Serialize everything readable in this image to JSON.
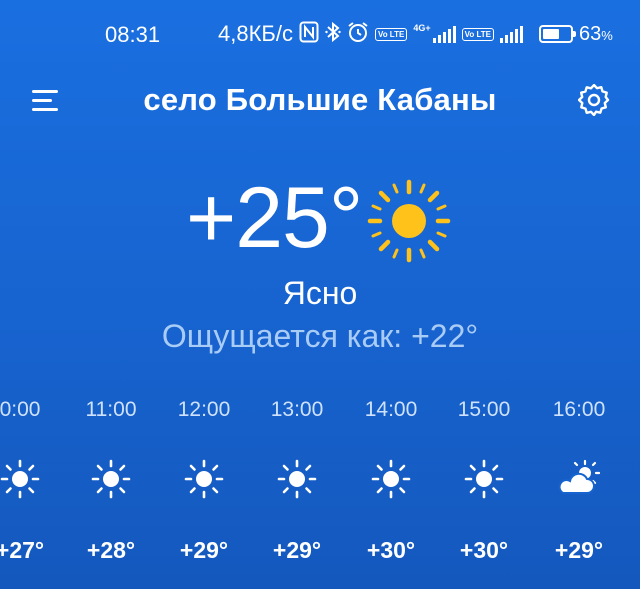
{
  "status_bar": {
    "time": "08:31",
    "net_speed": "4,8КБ/с",
    "nfc_icon": "nfc-icon",
    "bluetooth_icon": "bluetooth-icon",
    "alarm_icon": "alarm-icon",
    "sim1_label": "Vo LTE",
    "sim1_network": "4G+",
    "sim2_label": "Vo LTE",
    "battery_level": 0.63,
    "battery_pct": "63",
    "battery_suffix": "%"
  },
  "header": {
    "menu_icon": "menu-icon",
    "title": "село Большие Кабаны",
    "settings_icon": "gear-icon"
  },
  "current": {
    "temp": "+25°",
    "icon": "sun-icon",
    "condition": "Ясно",
    "feels_like": "Ощущается как: +22°"
  },
  "hourly": [
    {
      "time": "0:00",
      "icon": "sun-icon",
      "temp": "+27°"
    },
    {
      "time": "11:00",
      "icon": "sun-icon",
      "temp": "+28°"
    },
    {
      "time": "12:00",
      "icon": "sun-icon",
      "temp": "+29°"
    },
    {
      "time": "13:00",
      "icon": "sun-icon",
      "temp": "+29°"
    },
    {
      "time": "14:00",
      "icon": "sun-icon",
      "temp": "+30°"
    },
    {
      "time": "15:00",
      "icon": "sun-icon",
      "temp": "+30°"
    },
    {
      "time": "16:00",
      "icon": "partly-cloudy-icon",
      "temp": "+29°"
    }
  ],
  "colors": {
    "background_top": "#1a6fe0",
    "background_bottom": "#1458bd",
    "sun_yellow": "#ffc21a",
    "feels_text": "#a9ccf6"
  }
}
